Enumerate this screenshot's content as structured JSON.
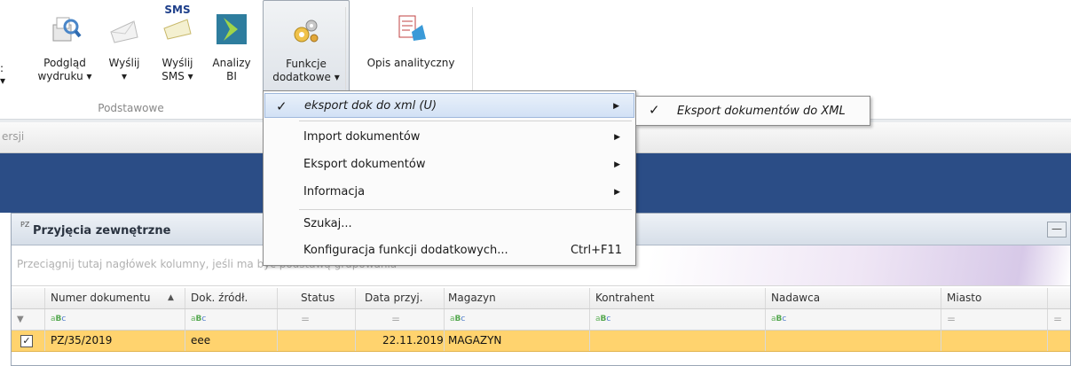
{
  "ribbon": {
    "buttons": [
      {
        "label": "Podgląd\nwydruku ▾"
      },
      {
        "label": "Wyślij\n▾"
      },
      {
        "label": "Wyślij\nSMS ▾"
      },
      {
        "label": "Analizy\nBI"
      },
      {
        "label": "Funkcje\ndodatkowe ▾"
      },
      {
        "label": "Opis analityczny"
      }
    ],
    "sms_badge": "SMS",
    "group_label": "Podstawowe"
  },
  "version_strip": {
    "text": "ersji"
  },
  "window": {
    "badge": "PZ",
    "title": "Przyjęcia zewnętrzne",
    "minimize_label": "—",
    "group_hint": "Przeciągnij tutaj nagłówek kolumny, jeśli ma być podstawą grupowania"
  },
  "grid": {
    "headers": [
      "Numer dokumentu",
      "Dok. źródł.",
      "Status",
      "Data przyj.",
      "Magazyn",
      "Kontrahent",
      "Nadawca",
      "Miasto"
    ],
    "sort_indicator": "▲",
    "filter_eq": "=",
    "rows": [
      {
        "numer": "PZ/35/2019",
        "dok": "eee",
        "status": "",
        "data": "22.11.2019",
        "magazyn": "MAGAZYN",
        "kontrahent": "",
        "nadawca": "",
        "miasto": ""
      }
    ]
  },
  "menu": {
    "items": [
      {
        "label": "eksport dok do xml (U)",
        "checked": true
      },
      {
        "label": "Import dokumentów"
      },
      {
        "label": "Eksport dokumentów"
      },
      {
        "label": "Informacja"
      },
      {
        "label": "Szukaj..."
      },
      {
        "label": "Konfiguracja funkcji dodatkowych...",
        "shortcut": "Ctrl+F11"
      }
    ],
    "submenu": {
      "label": "Eksport dokumentów do XML"
    }
  },
  "colors": {
    "blue_band": "#2b4d86",
    "row_highlight": "#ffd36e",
    "menu_selection": "#d2e1f5"
  }
}
